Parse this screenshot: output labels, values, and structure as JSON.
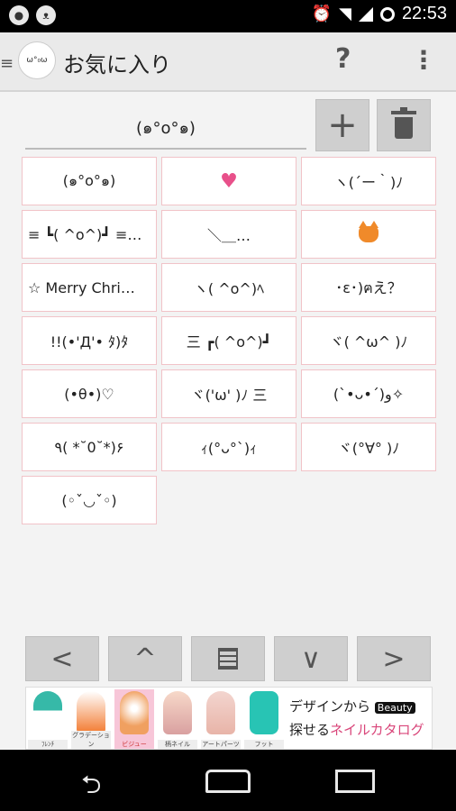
{
  "status_bar": {
    "time": "22:53",
    "left_icons": [
      "notification-icon",
      "cat-notification-icon"
    ],
    "right_icons": [
      "alarm-icon",
      "wifi-icon",
      "signal-icon",
      "circle-icon"
    ]
  },
  "action_bar": {
    "logo_text": "ω°₀ω",
    "title": "お気に入り",
    "help_label": "?",
    "overflow_label": "⋮"
  },
  "input": {
    "value": "(๑°o°๑)"
  },
  "toolbar": {
    "add_label": "+"
  },
  "favorites": [
    "(๑°o°๑)",
    "♥",
    "ヽ(´ー｀)ﾉ",
    "≡ ┗( ^o^)┛ ≡…",
    "  ＼＿…",
    "cat",
    "☆ Merry Chri…",
    "ヽ( ^o^)ﾍ",
    "･ε･)ฅえ？",
    "!!(•'Д'• ﾀ)ﾀ",
    "三 ┏( ^o^)┛",
    "ヾ( ^ω^ )ﾉ",
    "(•θ•)♡",
    "ヾ('ω' )ﾉ 三",
    "(`•ᴗ•´)و✧",
    "٩( *˘0˘*)۶",
    "ｨ(°ᴗ°`)ｨ",
    "ヾ(°∀° )ﾉ",
    "(◦ˇ◡ˇ◦)"
  ],
  "nav": {
    "prev": "<",
    "up": "^",
    "down": "∨",
    "next": ">"
  },
  "ad": {
    "labels": [
      "ﾌﾚﾝﾁ",
      "グラデーション",
      "ビジュー",
      "柄ネイル",
      "アートパーツ",
      "フット"
    ],
    "line1_a": "デザインから",
    "beauty": "Beauty",
    "line2_a": "探せる",
    "line2_b": "ネイルカタログ",
    "colors": [
      "#36b9a8",
      "#f2762a",
      "#f0a060",
      "#f7d9c9",
      "#e8b4a8",
      "#28c4b4"
    ]
  }
}
